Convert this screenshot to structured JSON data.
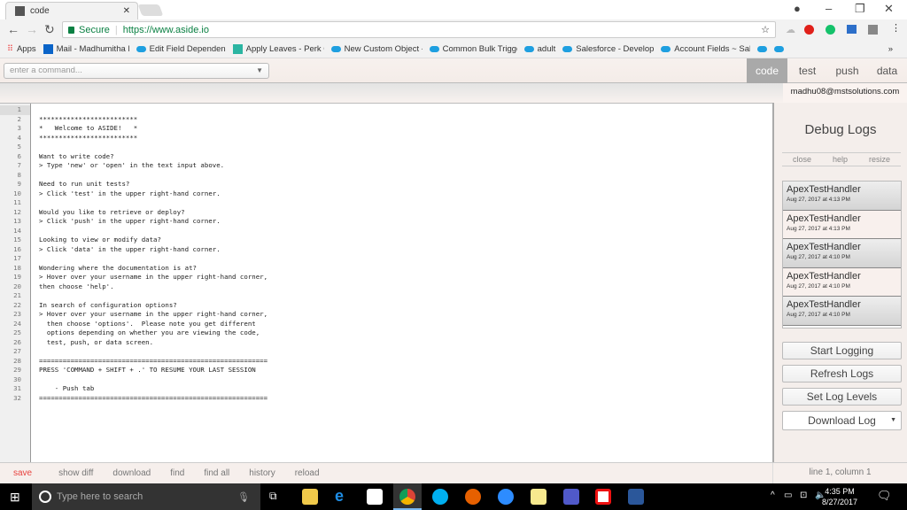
{
  "browser": {
    "tab_title": "code",
    "security_label": "Secure",
    "url": "https://www.aside.io",
    "bookmarks": [
      "Apps",
      "Mail - Madhumitha M",
      "Edit Field Dependenc",
      "Apply Leaves - Perk C",
      "New Custom Object -",
      "Common Bulk Trigge",
      "adult",
      "Salesforce - Develope",
      "Account Fields ~ Sale"
    ],
    "overflow": "»"
  },
  "toolbar": {
    "command_placeholder": "enter a command...",
    "tabs": [
      "code",
      "test",
      "push",
      "data"
    ],
    "active_tab": "code"
  },
  "user": "madhu08@mstsolutions.com",
  "editor": {
    "lines": [
      "",
      "*************************",
      "*   Welcome to ASIDE!   *",
      "*************************",
      "",
      "Want to write code?",
      "> Type 'new' or 'open' in the text input above.",
      "",
      "Need to run unit tests?",
      "> Click 'test' in the upper right-hand corner.",
      "",
      "Would you like to retrieve or deploy?",
      "> Click 'push' in the upper right-hand corner.",
      "",
      "Looking to view or modify data?",
      "> Click 'data' in the upper right-hand corner.",
      "",
      "Wondering where the documentation is at?",
      "> Hover over your username in the upper right-hand corner,",
      "then choose 'help'.",
      "",
      "In search of configuration options?",
      "> Hover over your username in the upper right-hand corner,",
      "  then choose 'options'.  Please note you get different",
      "  options depending on whether you are viewing the code,",
      "  test, push, or data screen.",
      "",
      "==========================================================",
      "PRESS 'COMMAND + SHIFT + .' TO RESUME YOUR LAST SESSION",
      "",
      "    - Push tab",
      "=========================================================="
    ]
  },
  "debug": {
    "title": "Debug Logs",
    "links": [
      "close",
      "help",
      "resize"
    ],
    "logs": [
      {
        "name": "ApexTestHandler",
        "date": "Aug 27, 2017 at 4:13 PM"
      },
      {
        "name": "ApexTestHandler",
        "date": "Aug 27, 2017 at 4:13 PM"
      },
      {
        "name": "ApexTestHandler",
        "date": "Aug 27, 2017 at 4:10 PM"
      },
      {
        "name": "ApexTestHandler",
        "date": "Aug 27, 2017 at 4:10 PM"
      },
      {
        "name": "ApexTestHandler",
        "date": "Aug 27, 2017 at 4:10 PM"
      }
    ],
    "buttons": [
      "Start Logging",
      "Refresh Logs",
      "Set Log Levels"
    ],
    "download_select": "Download Log"
  },
  "footer": {
    "items": [
      "save",
      "show diff",
      "download",
      "find",
      "find all",
      "history",
      "reload"
    ],
    "position": "line 1, column 1",
    "save_color": "#e8433f"
  },
  "taskbar": {
    "search_placeholder": "Type here to search",
    "time": "4:35 PM",
    "date": "8/27/2017"
  }
}
